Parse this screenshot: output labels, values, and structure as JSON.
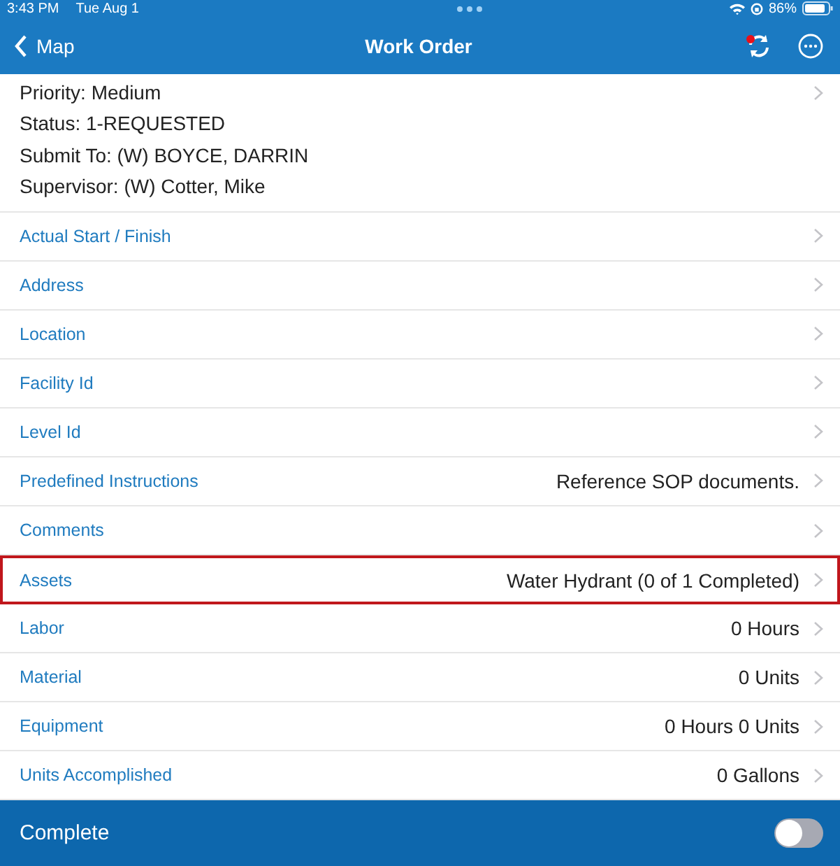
{
  "status_bar": {
    "time": "3:43 PM",
    "date": "Tue Aug 1",
    "battery": "86%"
  },
  "nav": {
    "back": "Map",
    "title": "Work Order",
    "sync_pending": true
  },
  "summary": [
    "Priority: Medium",
    "Status: 1-REQUESTED",
    "Submit To: (W) BOYCE, DARRIN",
    "Supervisor: (W) Cotter, Mike"
  ],
  "rows": [
    {
      "label": "Actual Start / Finish",
      "selected": false
    },
    {
      "label": "Address",
      "selected": false
    },
    {
      "label": "Location",
      "selected": false
    },
    {
      "label": "Facility Id",
      "selected": false
    },
    {
      "label": "Level Id",
      "selected": false
    },
    {
      "label": "Predefined Instructions",
      "value": "Reference SOP documents.",
      "selected": false
    },
    {
      "label": "Comments",
      "selected": false
    },
    {
      "label": "Assets",
      "value": "Water Hydrant (0 of 1 Completed)",
      "selected": true
    },
    {
      "label": "Labor",
      "value": "0 Hours",
      "selected": false
    },
    {
      "label": "Material",
      "value": "0 Units",
      "selected": false
    },
    {
      "label": "Equipment",
      "value": "0 Hours 0 Units",
      "selected": false
    },
    {
      "label": "Units Accomplished",
      "value": "0 Gallons",
      "selected": false
    }
  ],
  "footer": {
    "label": "Complete",
    "on": false
  }
}
